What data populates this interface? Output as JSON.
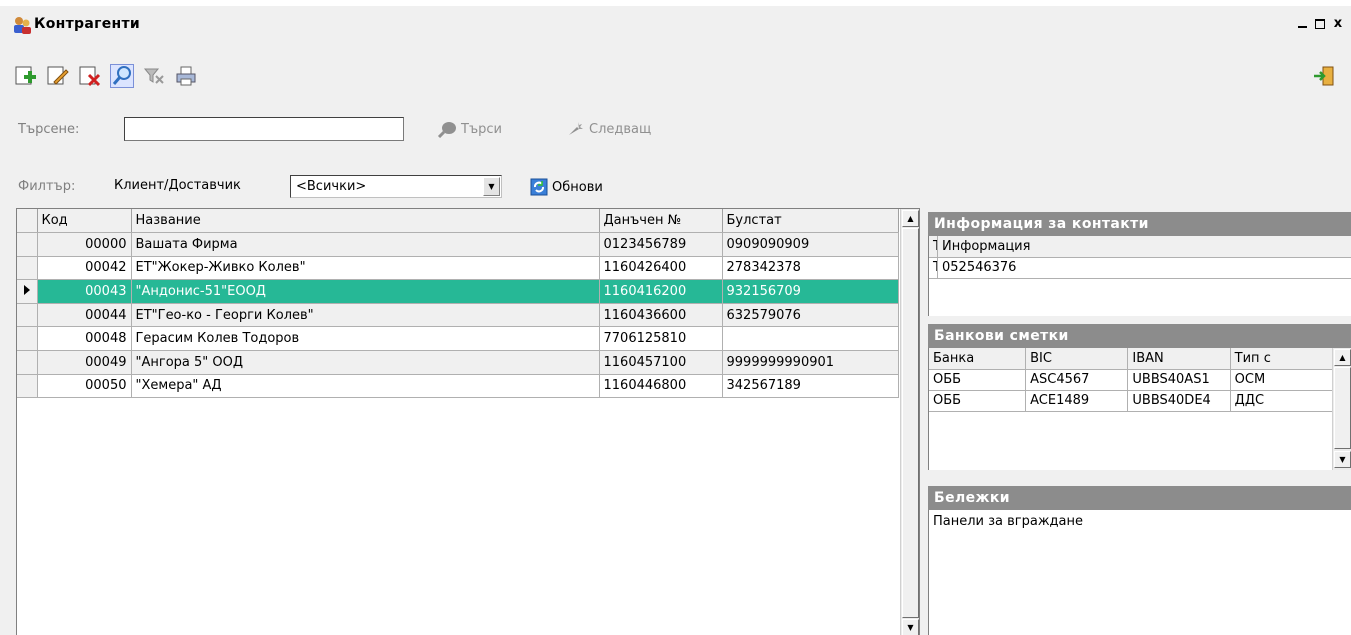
{
  "window": {
    "title": "Контрагенти",
    "minimize": "_",
    "maximize": "□",
    "close": "x"
  },
  "toolbar": {
    "add": "add-icon",
    "edit": "edit-icon",
    "delete": "delete-icon",
    "search": "search-icon",
    "clear_filter": "clear-filter-icon",
    "print": "print-icon",
    "exit": "exit-icon"
  },
  "search": {
    "label": "Търсене:",
    "value": "",
    "search_button": "Търси",
    "next_button": "Следващ"
  },
  "filter": {
    "label": "Филтър:",
    "type_label": "Клиент/Доставчик",
    "selected": "<Всички>",
    "refresh_button": "Обнови"
  },
  "grid": {
    "columns": [
      "Код",
      "Название",
      "Данъчен №",
      "Булстат"
    ],
    "rows": [
      {
        "code": "00000",
        "name": "Вашата Фирма",
        "tax": "0123456789",
        "bulstat": "0909090909"
      },
      {
        "code": "00042",
        "name": "ЕТ\"Жокер-Живко Колев\"",
        "tax": "1160426400",
        "bulstat": "278342378"
      },
      {
        "code": "00043",
        "name": "\"Андонис-51\"ЕООД",
        "tax": "1160416200",
        "bulstat": "932156709"
      },
      {
        "code": "00044",
        "name": "ЕТ\"Гео-ко - Георги Колев\"",
        "tax": "1160436600",
        "bulstat": "632579076"
      },
      {
        "code": "00048",
        "name": "Герасим Колев Тодоров",
        "tax": "7706125810",
        "bulstat": ""
      },
      {
        "code": "00049",
        "name": "\"Ангора 5\" ООД",
        "tax": "1160457100",
        "bulstat": "9999999990901"
      },
      {
        "code": "00050",
        "name": "\"Хемера\" АД",
        "tax": "1160446800",
        "bulstat": "342567189"
      }
    ],
    "selected_index": 2
  },
  "contacts": {
    "title": "Информация за контакти",
    "columns": [
      "Тип",
      "Информация"
    ],
    "rows": [
      {
        "type": "Тел.",
        "info": "052546376"
      }
    ]
  },
  "bank": {
    "title": "Банкови сметки",
    "columns": [
      "Банка",
      "BIC",
      "IBAN",
      "Тип с"
    ],
    "rows": [
      {
        "bank": "ОББ",
        "bic": "ASC4567",
        "iban": "UBBS40AS1",
        "type": "ОСМ"
      },
      {
        "bank": "ОББ",
        "bic": "ACE1489",
        "iban": "UBBS40DE4",
        "type": "ДДС"
      }
    ]
  },
  "notes": {
    "title": "Бележки",
    "text": "Панели за вграждане"
  },
  "colors": {
    "selected_row": "#26b896",
    "panel_header": "#8c8c8c"
  }
}
